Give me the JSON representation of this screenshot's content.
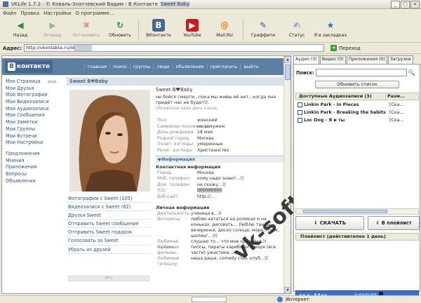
{
  "window": {
    "title": "VKLife 1.7.2 - © Коваль-Златчевский Вадим - В Контакте",
    "title_redacted": "Sweet Baby",
    "buttons": [
      "_",
      "□",
      "×"
    ]
  },
  "menu": [
    "Файл",
    "Правка",
    "Настройки",
    "О программе..."
  ],
  "toolbar": [
    {
      "label": "Назад",
      "icon": "back-arrow-icon",
      "glyph": "◀",
      "color": "#2e8b2e",
      "disabled": false
    },
    {
      "label": "Вперед",
      "icon": "forward-arrow-icon",
      "glyph": "▶",
      "color": "#2e8b2e",
      "disabled": true
    },
    {
      "label": "Остановить",
      "icon": "stop-icon",
      "glyph": "✖",
      "color": "#c0392b",
      "disabled": true
    },
    {
      "label": "Обновить",
      "icon": "refresh-icon",
      "glyph": "↻",
      "color": "#2e8b2e",
      "disabled": false
    },
    {
      "label": "ВКонтакте",
      "icon": "vk-icon",
      "glyph": "B",
      "color": "#45688e",
      "disabled": false
    },
    {
      "label": "YouTube",
      "icon": "youtube-icon",
      "glyph": "▶",
      "color": "#cc181e",
      "disabled": false
    },
    {
      "label": "Mail.RU",
      "icon": "mailru-icon",
      "glyph": "@",
      "color": "#f07e1f",
      "disabled": false
    },
    {
      "label": "Граффити",
      "icon": "graffiti-icon",
      "glyph": "✎",
      "color": "#1f63b5",
      "disabled": false
    },
    {
      "label": "Статус",
      "icon": "status-icon",
      "glyph": "✍",
      "color": "#3a7bd5",
      "disabled": false
    },
    {
      "label": "Я в закладках",
      "icon": "bookmarks-icon",
      "glyph": "★",
      "color": "#2e6fb0",
      "disabled": false
    }
  ],
  "address": {
    "label": "Адрес:",
    "value": "http://vkontakte.ru/id",
    "go_label": "Переход"
  },
  "vk": {
    "logo_b": "B",
    "logo_text": "контакте",
    "nav": [
      "главная",
      "поиск",
      "группы",
      "люди",
      "объявления",
      "пригласить",
      "выйти"
    ],
    "leftnav": [
      "Моя Страница",
      "Мои Друзья",
      "Мои Фотографии",
      "Мои Видеозаписи",
      "Мои Аудиозаписи",
      "Мои Сообщения",
      "Мои Заметки",
      "Мои Группы",
      "Мои Встречи",
      "Мои Настройки"
    ],
    "leftnav_edit": "ред.",
    "leftnav2": [
      "Предложения",
      "Мнения",
      "Приложения",
      "Вопросы",
      "Объявления"
    ],
    "profile_header": "Sweet B♥Baby",
    "name": "Sweet B♥Baby",
    "status": "не бойся смерти...пока мы живы её нет...когда она придёт нас не будет)).",
    "updated": "Обновлено один день назад",
    "info": [
      {
        "k": "Пол:",
        "v": "женский"
      },
      {
        "k": "Семейное положение:",
        "v": "не замужем"
      },
      {
        "k": "День рождения:",
        "v": "18 мая"
      },
      {
        "k": "Родной город:",
        "v": "Москва"
      },
      {
        "k": "Полит. взгляды:",
        "v": "умеренные"
      },
      {
        "k": "Религ. взгляды:",
        "v": "Христианство"
      }
    ],
    "info_section": "Информация",
    "contact_title": "Контактная информация",
    "contact": [
      {
        "k": "Город:",
        "v": "Москва"
      },
      {
        "k": "Моб. телефон:",
        "v": "кому надо знают...))"
      },
      {
        "k": "Дом. телефон:",
        "v": "не скажу...))"
      },
      {
        "k": "ICQ:",
        "v": ""
      },
      {
        "k": "Веб-сайт:",
        "v": "http://..."
      }
    ],
    "personal_title": "Личная информация",
    "personal": [
      {
        "k": "Деятельность:",
        "v": "ученица в...))"
      },
      {
        "k": "Интересы:",
        "v": "люблю кататься на роликах и на коньках, рисовать... Люблю танцы, вечеринки, диско солнце, море, пляж, шопинг...)))"
      },
      {
        "k": "Любимая музыка:",
        "v": "слушаю то... что мне нравится:))"
      },
      {
        "k": "Любимые фильмы:",
        "v": "пипсы, пираты карибского моря (все части) ужастики...))"
      },
      {
        "k": "Любимые телешоу:",
        "v": "наша раша, comedy club, клуб...))"
      }
    ],
    "photo_links": [
      "Фотографии с Sweet (105)",
      "Видеозаписи с Sweet (62)",
      "Друзья Sweet",
      "Отправить Sweet сообщение",
      "Отправить Sweet подарок",
      "Голосовать за Sweet",
      "Убрать из друзей"
    ],
    "rating": "96%"
  },
  "watermark": "vk-soft.net",
  "panel": {
    "tabs": [
      "Аудио (3)",
      "Видео (0)",
      "Приложения (0)",
      "Загрузки"
    ],
    "search_label": "Поиск:",
    "refresh_label": "Обновить список",
    "col_name": "Доступные Аудиозаписи (3)",
    "col_dl": "Разм...",
    "tracks": [
      {
        "name": "Linkin Park - In Pieces",
        "dl": "[Ска..."
      },
      {
        "name": "Linkin Park - Breaking the habits",
        "dl": "[Ска..."
      },
      {
        "name": "Loc Dog - Я и ты",
        "dl": "[Ска..."
      }
    ],
    "download_label": "СКАЧАТЬ",
    "playlist_label": "В плейлист",
    "playlist_header": "Плейлист (действителен 1 день)",
    "time": "0:00/0:00"
  },
  "statusbar": {
    "zone": "Интернет"
  }
}
